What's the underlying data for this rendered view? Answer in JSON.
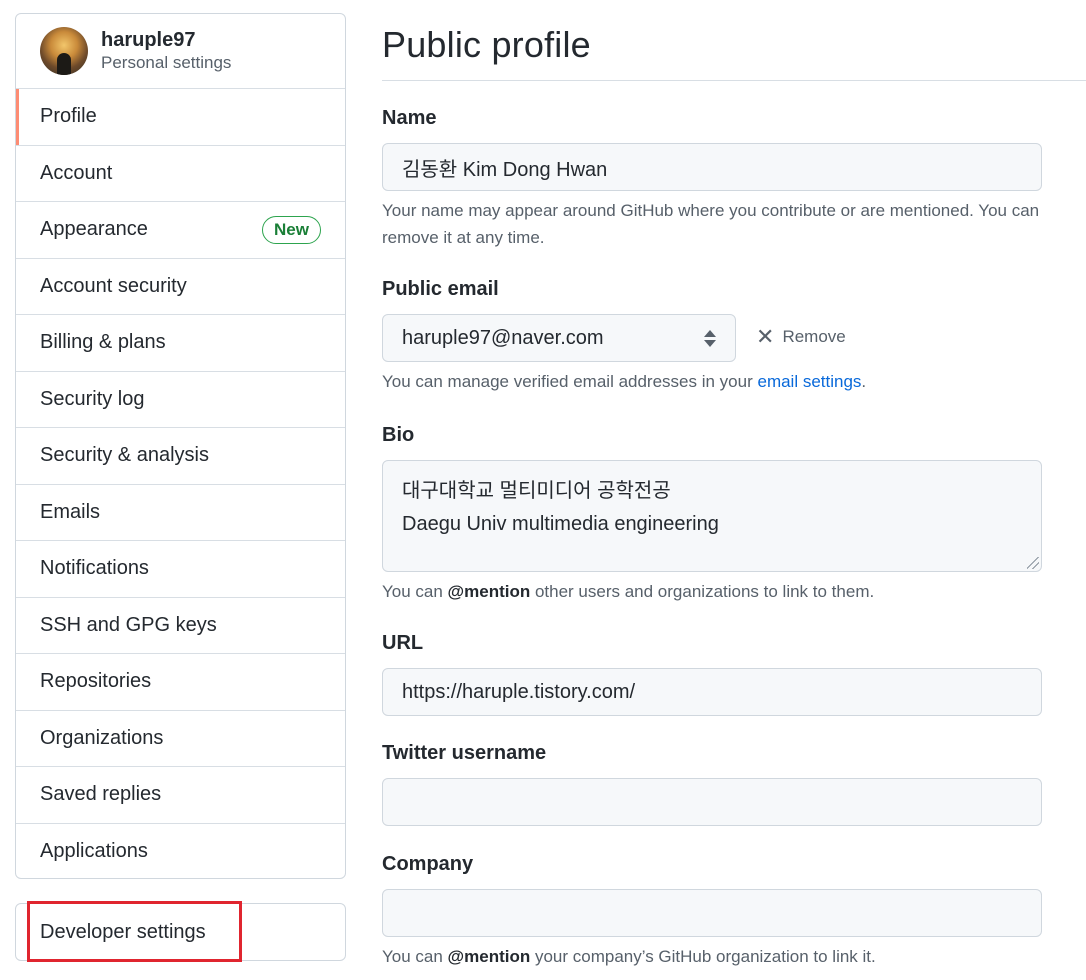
{
  "user": {
    "name": "haruple97",
    "subtitle": "Personal settings"
  },
  "sidebar": {
    "items": [
      {
        "label": "Profile",
        "selected": true
      },
      {
        "label": "Account"
      },
      {
        "label": "Appearance",
        "badge": "New"
      },
      {
        "label": "Account security"
      },
      {
        "label": "Billing & plans"
      },
      {
        "label": "Security log"
      },
      {
        "label": "Security & analysis"
      },
      {
        "label": "Emails"
      },
      {
        "label": "Notifications"
      },
      {
        "label": "SSH and GPG keys"
      },
      {
        "label": "Repositories"
      },
      {
        "label": "Organizations"
      },
      {
        "label": "Saved replies"
      },
      {
        "label": "Applications"
      }
    ],
    "developer_settings": "Developer settings",
    "highlight_color": "#e0252f",
    "selected_accent": "#fd8c73"
  },
  "main": {
    "title": "Public profile",
    "name": {
      "label": "Name",
      "value": "김동환 Kim Dong Hwan",
      "note_line1": "Your name may appear around GitHub where you contribute or are mentioned. You can",
      "note_line2": "remove it at any time."
    },
    "email": {
      "label": "Public email",
      "value": "haruple97@naver.com",
      "remove_label": "Remove",
      "note_prefix": "You can manage verified email addresses in your ",
      "note_link": "email settings",
      "note_suffix": "."
    },
    "bio": {
      "label": "Bio",
      "line1": "대구대학교 멀티미디어 공학전공",
      "line2": "Daegu Univ multimedia engineering",
      "note_prefix": "You can ",
      "note_mention": "@mention",
      "note_suffix": " other users and organizations to link to them."
    },
    "url": {
      "label": "URL",
      "value": "https://haruple.tistory.com/"
    },
    "twitter": {
      "label": "Twitter username",
      "value": ""
    },
    "company": {
      "label": "Company",
      "value": "",
      "note_prefix": "You can ",
      "note_mention": "@mention",
      "note_suffix": " your company’s GitHub organization to link it."
    }
  }
}
